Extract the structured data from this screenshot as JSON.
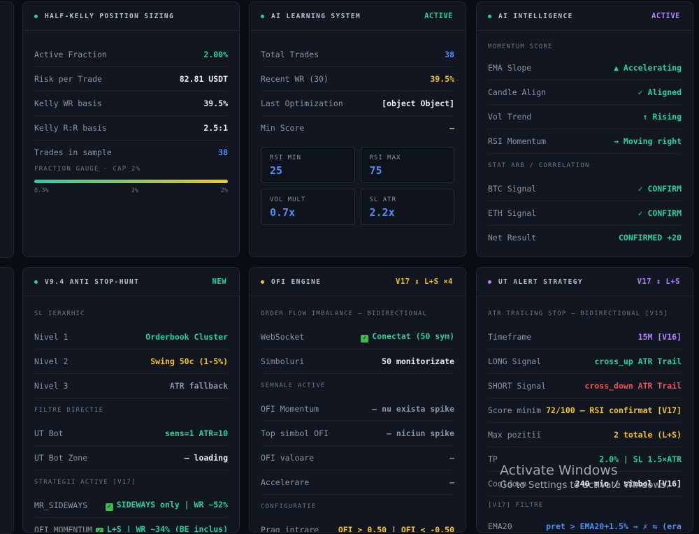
{
  "colors": {
    "green": "#22d3a0",
    "yellow": "#f5c518",
    "blue": "#4f8ef7",
    "purple": "#b083ff",
    "red": "#f05252"
  },
  "kelly": {
    "title": "HALF-KELLY POSITION SIZING",
    "rows": [
      {
        "k": "Active Fraction",
        "v": "2.00%"
      },
      {
        "k": "Risk per Trade",
        "v": "82.81 USDT"
      },
      {
        "k": "Kelly WR basis",
        "v": "39.5%"
      },
      {
        "k": "Kelly R:R basis",
        "v": "2.5:1"
      },
      {
        "k": "Trades in sample",
        "v": "38"
      }
    ],
    "gauge_label": "FRACTION GAUGE · CAP 2%",
    "gauge_fraction": 1.0,
    "ticks": [
      "0.3%",
      "1%",
      "2%"
    ]
  },
  "learning": {
    "title": "AI LEARNING SYSTEM",
    "badge": "ACTIVE",
    "rows": [
      {
        "k": "Total Trades",
        "v": "38"
      },
      {
        "k": "Recent WR (30)",
        "v": "39.5%"
      },
      {
        "k": "Last Optimization",
        "v": "[object Object]"
      },
      {
        "k": "Min Score",
        "v": "—"
      }
    ],
    "boxes": [
      {
        "label": "RSI MIN",
        "value": "25"
      },
      {
        "label": "RSI MAX",
        "value": "75"
      },
      {
        "label": "VOL MULT",
        "value": "0.7x"
      },
      {
        "label": "SL ATR",
        "value": "2.2x"
      }
    ]
  },
  "intel": {
    "title": "AI INTELLIGENCE",
    "badge": "ACTIVE",
    "sec1": "MOMENTUM SCORE",
    "rows1": [
      {
        "k": "EMA Slope",
        "v": "▲ Accelerating"
      },
      {
        "k": "Candle Align",
        "v": "✓ Aligned"
      },
      {
        "k": "Vol Trend",
        "v": "↑ Rising"
      },
      {
        "k": "RSI Momentum",
        "v": "→ Moving right"
      }
    ],
    "sec2": "STAT ARB / CORRELATION",
    "rows2": [
      {
        "k": "BTC Signal",
        "v": "✓ CONFIRM"
      },
      {
        "k": "ETH Signal",
        "v": "✓ CONFIRM"
      },
      {
        "k": "Net Result",
        "v": "CONFIRMED +20"
      }
    ]
  },
  "anti": {
    "title": "V9.4 ANTI STOP-HUNT",
    "badge": "NEW",
    "sec1": "SL IERARHIC",
    "rows1": [
      {
        "k": "Nivel 1",
        "v": "Orderbook Cluster"
      },
      {
        "k": "Nivel 2",
        "v": "Swing 50c (1-5%)"
      },
      {
        "k": "Nivel 3",
        "v": "ATR fallback"
      }
    ],
    "sec2": "FILTRE DIRECTIE",
    "rows2": [
      {
        "k": "UT Bot",
        "v": "sens=1 ATR=10"
      },
      {
        "k": "UT Bot Zone",
        "v": "— loading"
      }
    ],
    "sec3": "STRATEGII ACTIVE [V17]",
    "rows3": [
      {
        "k": "MR_SIDEWAYS",
        "v": "SIDEWAYS only | WR ~52%"
      },
      {
        "k": "OFI_MOMENTUM",
        "v": "L+S | WR ~34% (BE inclus)"
      }
    ]
  },
  "ofi": {
    "title": "OFI ENGINE",
    "badge": "V17 ↕ L+S ×4",
    "sec1": "ORDER FLOW IMBALANCE — BIDIRECTIONAL",
    "rows1": [
      {
        "k": "WebSocket",
        "v": "Conectat (50 sym)"
      },
      {
        "k": "Simboluri",
        "v": "50 monitorizate"
      }
    ],
    "sec2": "SEMNALE ACTIVE",
    "rows2": [
      {
        "k": "OFI Momentum",
        "v": "— nu exista spike"
      },
      {
        "k": "Top simbol OFI",
        "v": "— niciun spike"
      },
      {
        "k": "OFI valoare",
        "v": "—"
      },
      {
        "k": "Accelerare",
        "v": "—"
      }
    ],
    "sec3": "CONFIGURATIE",
    "rows3": [
      {
        "k": "Prag intrare",
        "v": "OFI > 0.50 | OFI < -0.50"
      }
    ]
  },
  "ut": {
    "title": "UT ALERT STRATEGY",
    "badge": "V17 ↕ L+S",
    "sec1": "ATR TRAILING STOP — BIDIRECTIONAL [V15]",
    "rows1": [
      {
        "k": "Timeframe",
        "v": "15M [V16]"
      },
      {
        "k": "LONG Signal",
        "v": "cross_up ATR Trail"
      },
      {
        "k": "SHORT Signal",
        "v": "cross_down ATR Trail"
      },
      {
        "k": "Score minim",
        "v": "72/100 — RSI confirmat [V17]"
      },
      {
        "k": "Max pozitii",
        "v": "2 totale (L+S)"
      },
      {
        "k": "TP",
        "v": "2.0% | SL 1.5×ATR"
      },
      {
        "k": "Cooldown",
        "v": "240 min / simbol [V16]"
      }
    ],
    "sec2": "[V17] FILTRE",
    "rows2": [
      {
        "k": "EMA20",
        "v": "pret > EMA20+1.5% → ✗ ⇆ (era"
      }
    ]
  },
  "watermark": {
    "line1": "Activate Windows",
    "line2": "Go to Settings to activate Windows."
  }
}
